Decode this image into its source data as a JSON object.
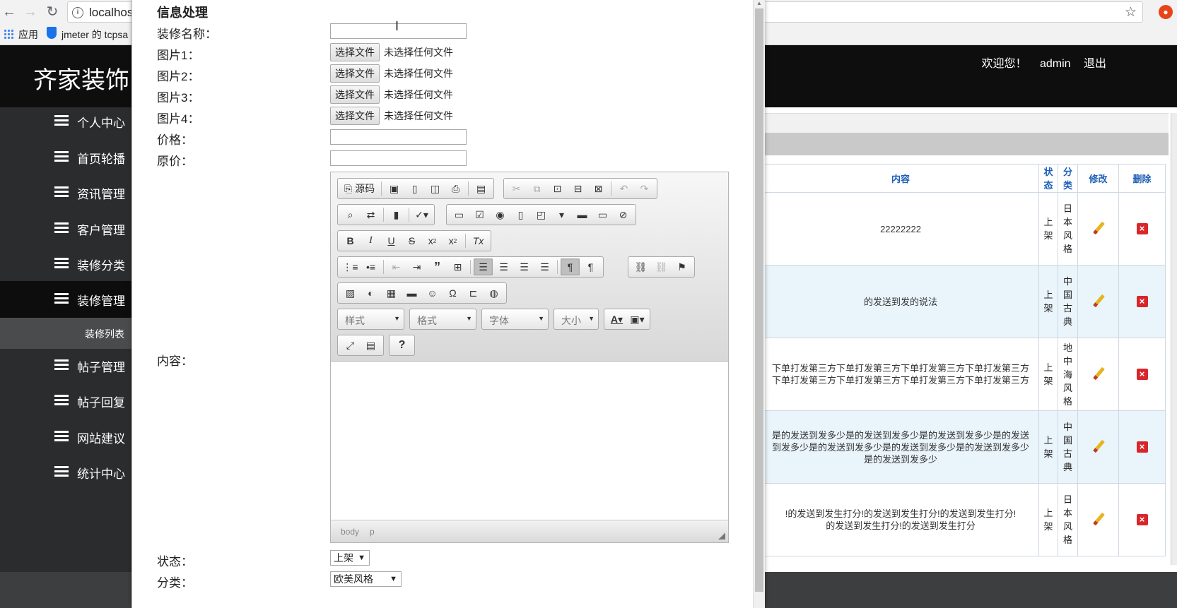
{
  "browser": {
    "url": "localhost",
    "bookmarks": {
      "apps": "应用",
      "jmeter": "jmeter 的 tcpsa"
    }
  },
  "app": {
    "brand": "齐家装饰",
    "welcome": "欢迎您！",
    "user": "admin",
    "logout": "退出"
  },
  "sidebar": {
    "items": [
      {
        "label": "个人中心"
      },
      {
        "label": "首页轮播"
      },
      {
        "label": "资讯管理"
      },
      {
        "label": "客户管理"
      },
      {
        "label": "装修分类"
      },
      {
        "label": "装修管理"
      },
      {
        "label": "帖子管理"
      },
      {
        "label": "帖子回复"
      },
      {
        "label": "网站建议"
      },
      {
        "label": "统计中心"
      }
    ],
    "active_sub": "装修列表"
  },
  "table": {
    "headers": [
      "内容",
      "状态",
      "分类",
      "修改",
      "删除"
    ],
    "rows": [
      {
        "content": [
          "22222222"
        ],
        "status": "上架",
        "category": "日本风格"
      },
      {
        "content": [
          "的发送到发的说法"
        ],
        "status": "上架",
        "category": "中国古典"
      },
      {
        "content": [
          "下单打发第三方下单打发第三方下单打发第三方下单打发第三方",
          "下单打发第三方下单打发第三方下单打发第三方下单打发第三方"
        ],
        "status": "上架",
        "category": "地中海风格"
      },
      {
        "content": [
          "是的发送到发多少是的发送到发多少是的发送到发多少是的发送",
          "到发多少是的发送到发多少是的发送到发多少是的发送到发多少",
          "是的发送到发多少"
        ],
        "status": "上架",
        "category": "中国古典"
      },
      {
        "content": [
          "!的发送到发生打分!的发送到发生打分!的发送到发生打分!",
          "的发送到发生打分!的发送到发生打分"
        ],
        "status": "上架",
        "category": "日本风格"
      }
    ]
  },
  "modal": {
    "title": "信息处理",
    "labels": {
      "name": "装修名称：",
      "pic1": "图片1：",
      "pic2": "图片2：",
      "pic3": "图片3：",
      "pic4": "图片4：",
      "price": "价格：",
      "orig_price": "原价：",
      "content": "内容：",
      "status": "状态：",
      "category": "分类："
    },
    "file_button": "选择文件",
    "file_none": "未选择任何文件",
    "status_value": "上架",
    "category_value": "欧美风格"
  },
  "editor": {
    "source_label": "源码",
    "combos": {
      "style": "样式",
      "format": "格式",
      "font": "字体",
      "size": "大小"
    },
    "status_path": {
      "body": "body",
      "p": "p"
    }
  }
}
